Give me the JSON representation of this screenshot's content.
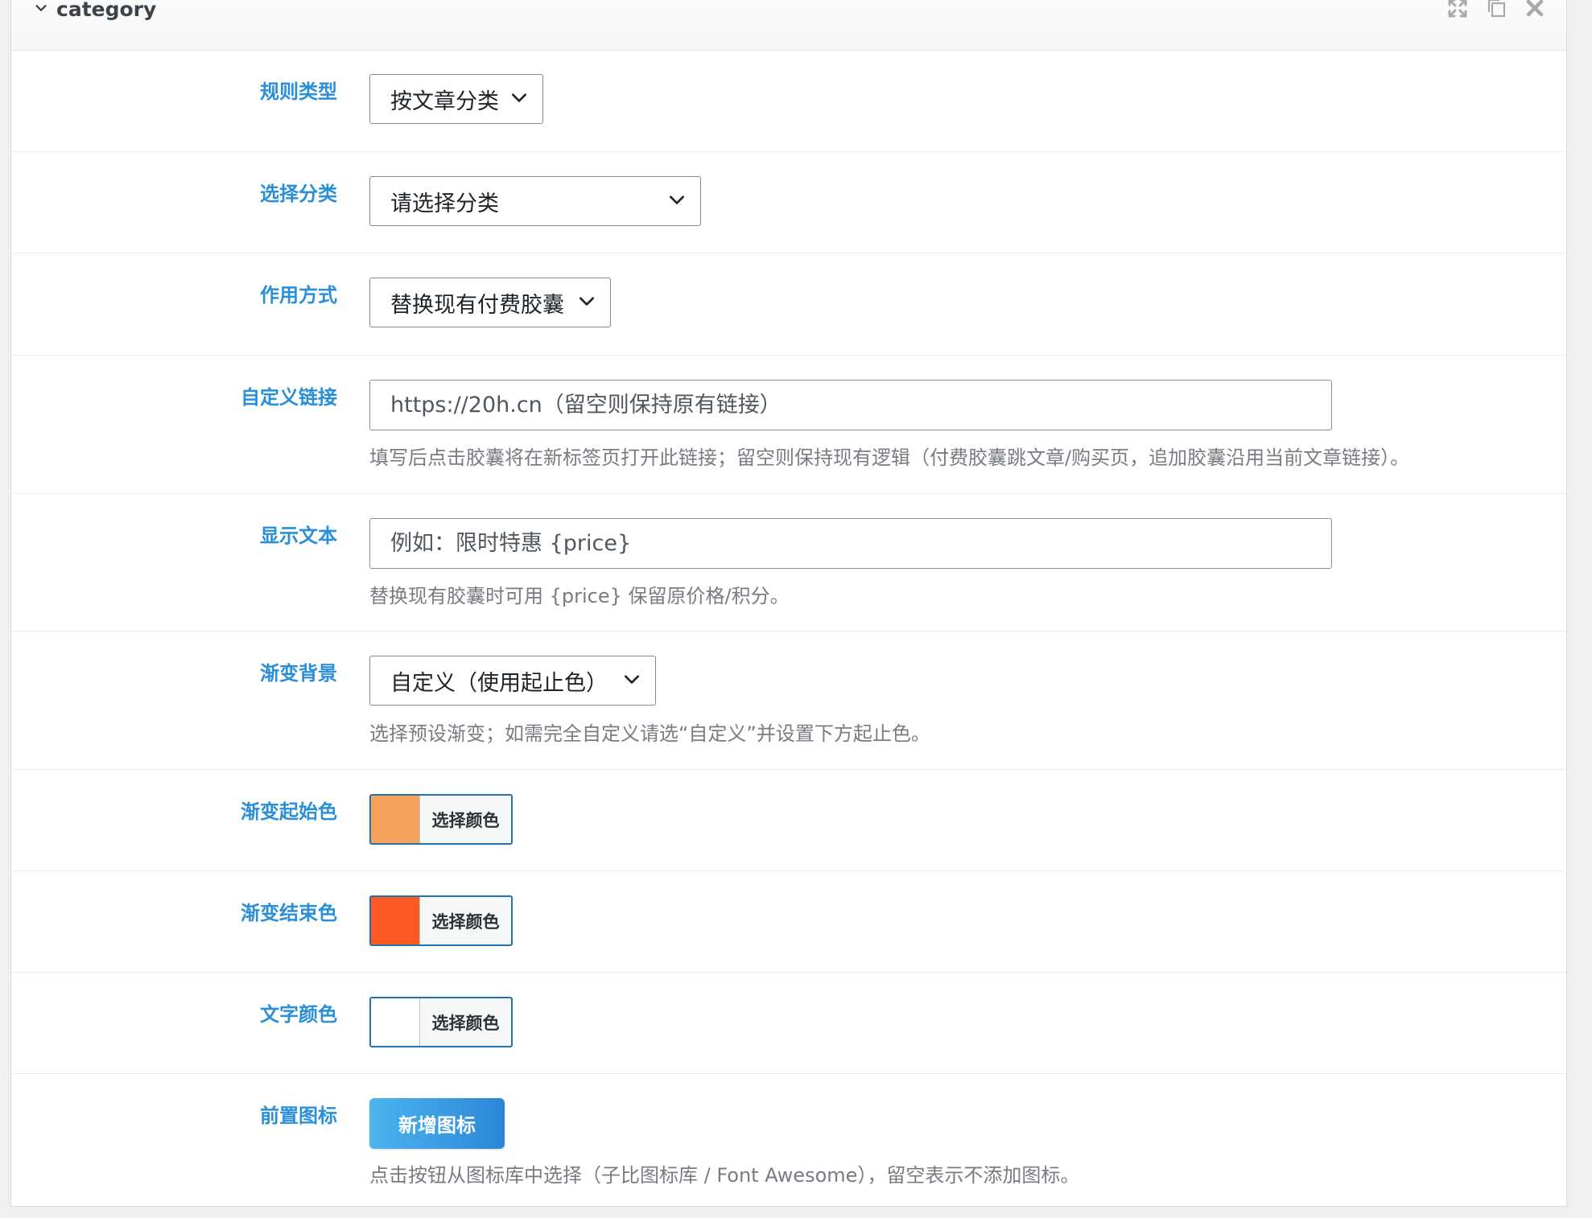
{
  "panel": {
    "title": "category"
  },
  "header_icons": [
    "expand-icon",
    "duplicate-icon",
    "delete-icon"
  ],
  "fields": {
    "rule_type": {
      "label": "规则类型",
      "value": "按文章分类"
    },
    "category": {
      "label": "选择分类",
      "value": "请选择分类"
    },
    "mode": {
      "label": "作用方式",
      "value": "替换现有付费胶囊"
    },
    "custom_link": {
      "label": "自定义链接",
      "value": "",
      "placeholder": "https://20h.cn（留空则保持原有链接）",
      "help": "填写后点击胶囊将在新标签页打开此链接；留空则保持现有逻辑（付费胶囊跳文章/购买页，追加胶囊沿用当前文章链接）。"
    },
    "display_text": {
      "label": "显示文本",
      "value": "",
      "placeholder": "例如：限时特惠 {price}",
      "help": "替换现有胶囊时可用 {price} 保留原价格/积分。"
    },
    "gradient_bg": {
      "label": "渐变背景",
      "value": "自定义（使用起止色）",
      "help": "选择预设渐变；如需完全自定义请选“自定义”并设置下方起止色。"
    },
    "gradient_start": {
      "label": "渐变起始色",
      "button": "选择颜色",
      "color": "#f4a15c"
    },
    "gradient_end": {
      "label": "渐变结束色",
      "button": "选择颜色",
      "color": "#fb5a22"
    },
    "text_color": {
      "label": "文字颜色",
      "button": "选择颜色",
      "color": "#ffffff"
    },
    "prefix_icon": {
      "label": "前置图标",
      "button": "新增图标",
      "help": "点击按钮从图标库中选择（子比图标库 / Font Awesome），留空表示不添加图标。"
    }
  }
}
